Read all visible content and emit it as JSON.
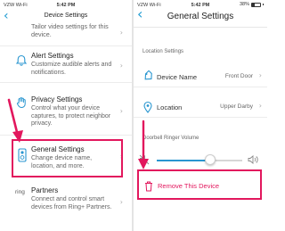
{
  "left_screen": {
    "status": {
      "carrier": "VZW Wi-Fi",
      "time": "5:42 PM"
    },
    "nav": {
      "title": "Device Settings",
      "back_icon": "chevron-left-icon"
    },
    "top_desc": "Tailor video settings for this device.",
    "items": [
      {
        "title": "Alert Settings",
        "desc": "Customize audible alerts and notifications.",
        "icon": "bell-icon"
      },
      {
        "title": "Privacy Settings",
        "desc": "Control what your device captures, to protect neighbor privacy.",
        "icon": "hand-icon"
      },
      {
        "title": "General Settings",
        "desc": "Change device name, location, and more.",
        "icon": "doorbell-icon"
      },
      {
        "title": "Partners",
        "desc": "Connect and control smart devices from Ring+ Partners.",
        "icon": "ring-logo-icon",
        "icon_text": "ring"
      }
    ]
  },
  "right_screen": {
    "status": {
      "carrier": "VZW Wi-Fi",
      "time": "5:42 PM",
      "battery": "38%",
      "battery_level": 0.38
    },
    "nav": {
      "title": "General Settings",
      "back_icon": "chevron-left-icon"
    },
    "location_section": "Location Settings",
    "fields": [
      {
        "label": "Device Name",
        "value": "Front Door",
        "icon": "tag-icon"
      },
      {
        "label": "Location",
        "value": "Upper Darby",
        "icon": "map-pin-icon"
      }
    ],
    "volume_section": "Doorbell Ringer Volume",
    "volume_level": 0.62,
    "remove_label": "Remove This Device"
  },
  "colors": {
    "accent": "#2996d0",
    "highlight": "#e2175d",
    "back": "#1b9ad2"
  }
}
